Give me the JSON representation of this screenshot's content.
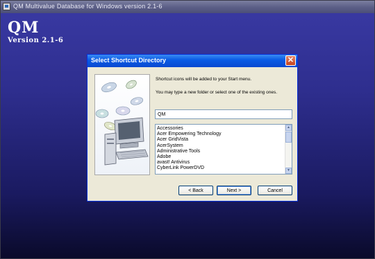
{
  "window": {
    "title": "QM Multivalue Database for Windows version 2.1-6"
  },
  "brand": {
    "name": "QM",
    "version": "Version 2.1-6"
  },
  "dialog": {
    "title": "Select Shortcut Directory",
    "close_symbol": "✕",
    "message1": "Shortcut icons will be added to your Start menu.",
    "message2": "You may type a new folder or select one of the existing ones.",
    "folder_value": "QM",
    "folders": [
      "Accessories",
      "Acer Empowering Technology",
      "Acer GridVista",
      "AcerSystem",
      "Administrative Tools",
      "Adobe",
      "avast! Antivirus",
      "CyberLink PowerDVD"
    ],
    "buttons": {
      "back": "< Back",
      "next": "Next >",
      "cancel": "Cancel"
    }
  },
  "icons": [
    "app-icon",
    "close-icon",
    "computer-cd-illustration",
    "scroll-up-icon",
    "scroll-down-icon"
  ],
  "colors": {
    "background": "#2e2e8e",
    "dialog_title": "#0b5de6",
    "dialog_body": "#ece9d8"
  }
}
